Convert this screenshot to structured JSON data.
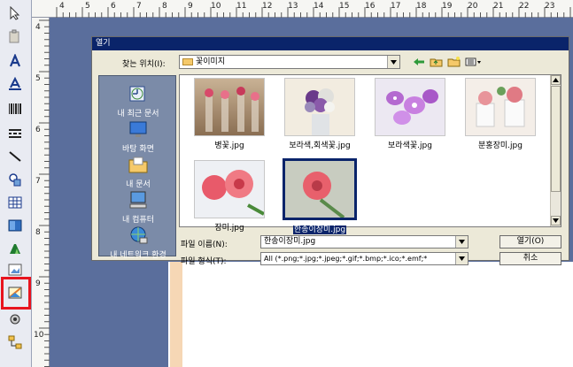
{
  "dialog": {
    "title": "열기",
    "look_in_label": "찾는 위치(I):",
    "look_in_value": "꽃이미지",
    "places": [
      {
        "label": "내 최근 문서",
        "icon": "recent-documents-icon"
      },
      {
        "label": "바탕 화면",
        "icon": "desktop-icon"
      },
      {
        "label": "내 문서",
        "icon": "my-documents-icon"
      },
      {
        "label": "내 컴퓨터",
        "icon": "my-computer-icon"
      },
      {
        "label": "내 네트워크 환경",
        "icon": "network-icon"
      }
    ],
    "files": [
      {
        "name": "병꽃.jpg",
        "selected": false
      },
      {
        "name": "보라색,회색꽃.jpg",
        "selected": false
      },
      {
        "name": "보라색꽃.jpg",
        "selected": false
      },
      {
        "name": "분홍장미.jpg",
        "selected": false
      },
      {
        "name": "장미.jpg",
        "selected": false
      },
      {
        "name": "한송이장미.jpg",
        "selected": true
      }
    ],
    "filename_label": "파일 이름(N):",
    "filename_value": "한송이장미.jpg",
    "filetype_label": "파일 형식(T):",
    "filetype_value": "All (*.png;*.jpg;*.jpeg;*.gif;*.bmp;*.ico;*.emf;*",
    "open_button": "열기(O)",
    "cancel_button": "취소"
  },
  "ruler": {
    "top": [
      "4",
      "5",
      "6",
      "7",
      "8",
      "9",
      "10",
      "11",
      "12",
      "13",
      "14",
      "15",
      "16",
      "17",
      "18",
      "19",
      "20",
      "21",
      "22",
      "23"
    ],
    "left": [
      "4",
      "5",
      "6",
      "7",
      "8",
      "9",
      "10"
    ]
  },
  "toolbar": {
    "tools": [
      "select-arrow-icon",
      "paste-icon",
      "text-icon",
      "text-box-icon",
      "barcode-icon",
      "barcode2d-icon",
      "line-icon",
      "shapes-icon",
      "table-icon",
      "rectangle-icon",
      "chart-icon",
      "image-frame-icon",
      "image-icon",
      "settings-icon",
      "hierarchy-icon"
    ],
    "highlighted_tool": "image-icon",
    "highlight_color": "#e8141e"
  }
}
